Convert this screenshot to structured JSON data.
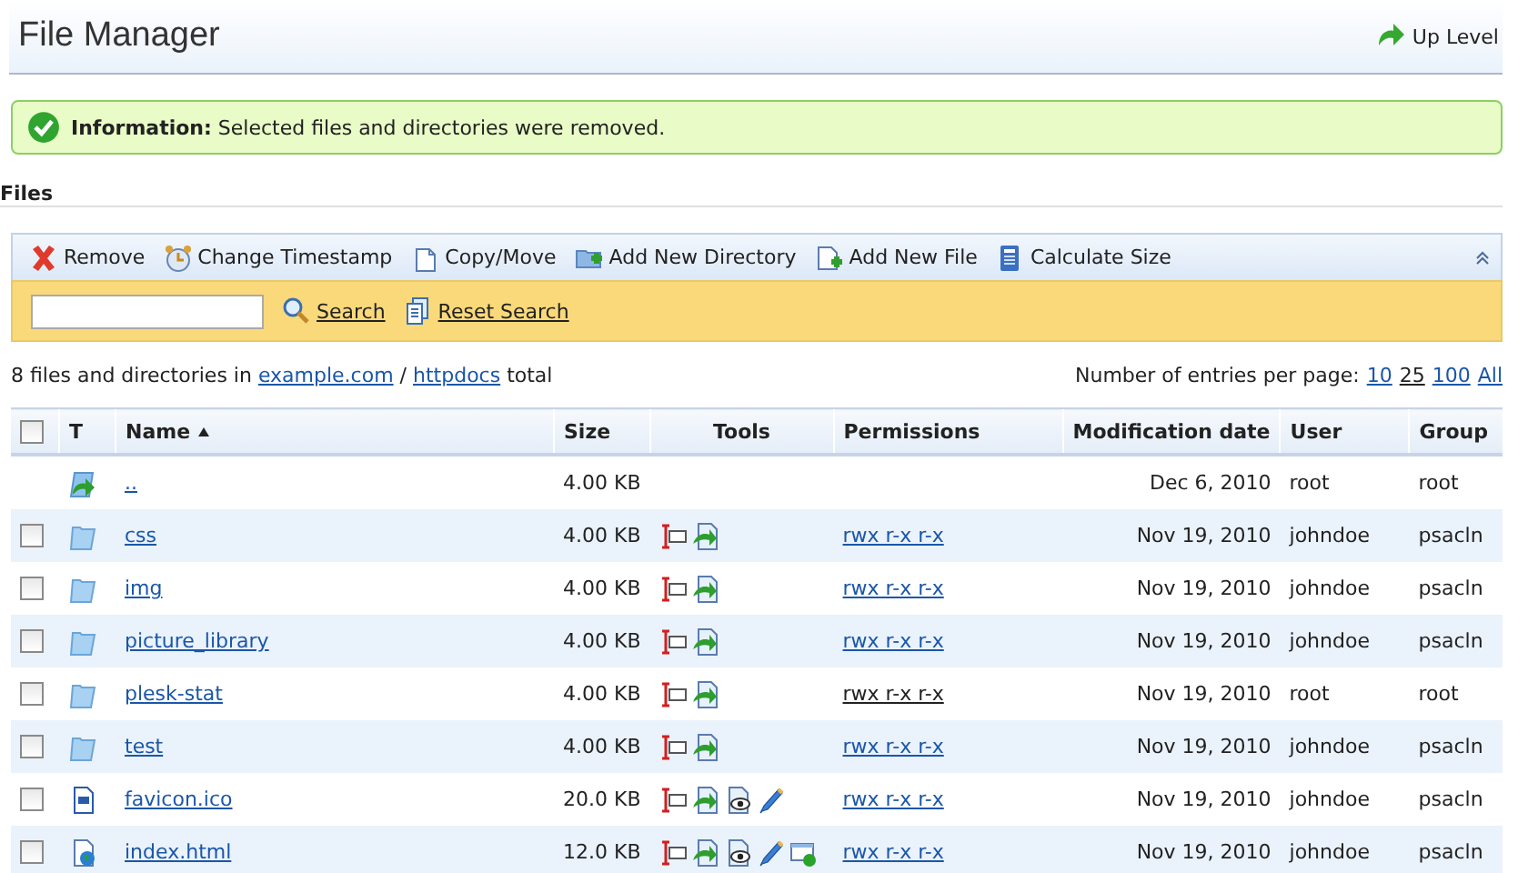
{
  "page": {
    "title": "File Manager",
    "up_level": "Up Level"
  },
  "message": {
    "label": "Information:",
    "text": "Selected files and directories were removed."
  },
  "section": {
    "title": "Files"
  },
  "toolbar": [
    {
      "kind": "remove",
      "label": "Remove"
    },
    {
      "kind": "timestamp",
      "label": "Change Timestamp"
    },
    {
      "kind": "copy",
      "label": "Copy/Move"
    },
    {
      "kind": "newdir",
      "label": "Add New Directory"
    },
    {
      "kind": "newfile",
      "label": "Add New File"
    },
    {
      "kind": "calc",
      "label": "Calculate Size"
    }
  ],
  "search": {
    "search_label": "Search",
    "reset_label": "Reset Search"
  },
  "summary": {
    "before": "8 files and directories in",
    "domain": "example.com",
    "sep": "/",
    "folder": "httpdocs",
    "after": "total"
  },
  "paging": {
    "label": "Number of entries per page:",
    "options": [
      {
        "label": "10",
        "selected": false
      },
      {
        "label": "25",
        "selected": true
      },
      {
        "label": "100",
        "selected": false
      },
      {
        "label": "All",
        "selected": false
      }
    ]
  },
  "table": {
    "columns": [
      {
        "label": "T"
      },
      {
        "label": "Name",
        "sorted": true
      },
      {
        "label": "Size"
      },
      {
        "label": "Tools"
      },
      {
        "label": "Permissions"
      },
      {
        "label": "Modification date"
      },
      {
        "label": "User"
      },
      {
        "label": "Group"
      }
    ],
    "header_checked": false,
    "rows": [
      {
        "kind": "parent",
        "name": "..",
        "size": "4.00 KB",
        "date": "Dec 6, 2010",
        "user": "root",
        "group": "root"
      },
      {
        "kind": "folder",
        "checked": false,
        "name": "css",
        "size": "4.00 KB",
        "tools": [
          {
            "kind": "rename"
          },
          {
            "kind": "change"
          }
        ],
        "permissions": "rwx r-x r-x",
        "perm_editable": true,
        "date": "Nov 19, 2010",
        "user": "johndoe",
        "group": "psacln"
      },
      {
        "kind": "folder",
        "checked": false,
        "name": "img",
        "size": "4.00 KB",
        "tools": [
          {
            "kind": "rename"
          },
          {
            "kind": "change"
          }
        ],
        "permissions": "rwx r-x r-x",
        "perm_editable": true,
        "date": "Nov 19, 2010",
        "user": "johndoe",
        "group": "psacln"
      },
      {
        "kind": "folder",
        "checked": false,
        "name": "picture_library",
        "size": "4.00 KB",
        "tools": [
          {
            "kind": "rename"
          },
          {
            "kind": "change"
          }
        ],
        "permissions": "rwx r-x r-x",
        "perm_editable": true,
        "date": "Nov 19, 2010",
        "user": "johndoe",
        "group": "psacln"
      },
      {
        "kind": "folder",
        "checked": false,
        "name": "plesk-stat",
        "size": "4.00 KB",
        "tools": [
          {
            "kind": "rename"
          },
          {
            "kind": "change"
          }
        ],
        "permissions": "rwx r-x r-x",
        "perm_editable": false,
        "date": "Nov 19, 2010",
        "user": "root",
        "group": "root"
      },
      {
        "kind": "folder",
        "checked": false,
        "name": "test",
        "size": "4.00 KB",
        "tools": [
          {
            "kind": "rename"
          },
          {
            "kind": "change"
          }
        ],
        "permissions": "rwx r-x r-x",
        "perm_editable": true,
        "date": "Nov 19, 2010",
        "user": "johndoe",
        "group": "psacln"
      },
      {
        "kind": "binary",
        "checked": false,
        "name": "favicon.ico",
        "size": "20.0 KB",
        "tools": [
          {
            "kind": "rename"
          },
          {
            "kind": "change"
          },
          {
            "kind": "view"
          },
          {
            "kind": "edit"
          }
        ],
        "permissions": "rwx r-x r-x",
        "perm_editable": true,
        "date": "Nov 19, 2010",
        "user": "johndoe",
        "group": "psacln"
      },
      {
        "kind": "web",
        "checked": false,
        "name": "index.html",
        "size": "12.0 KB",
        "tools": [
          {
            "kind": "rename"
          },
          {
            "kind": "change"
          },
          {
            "kind": "view"
          },
          {
            "kind": "edit"
          },
          {
            "kind": "html"
          }
        ],
        "permissions": "rwx r-x r-x",
        "perm_editable": true,
        "date": "Nov 19, 2010",
        "user": "johndoe",
        "group": "psacln"
      }
    ]
  }
}
